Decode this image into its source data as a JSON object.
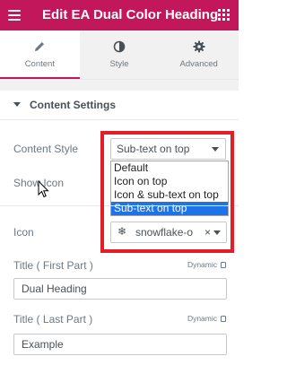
{
  "header": {
    "title": "Edit EA Dual Color Heading",
    "menu_icon": "hamburger-icon",
    "apps_icon": "grid-icon",
    "background": "#c2185b"
  },
  "tabs": [
    {
      "label": "Content",
      "icon": "pencil-icon",
      "active": true
    },
    {
      "label": "Style",
      "icon": "contrast-icon",
      "active": false
    },
    {
      "label": "Advanced",
      "icon": "gear-icon",
      "active": false
    }
  ],
  "section": {
    "title": "Content Settings"
  },
  "content_style": {
    "label": "Content Style",
    "value": "Sub-text on top",
    "options": [
      "Default",
      "Icon on top",
      "Icon & sub-text on top",
      "Sub-text on top"
    ],
    "selected_index": 3
  },
  "show_icon": {
    "label": "Show Icon"
  },
  "icon_field": {
    "label": "Icon",
    "value": "snowflake-o",
    "glyph": "❄",
    "clear": "×"
  },
  "title_first": {
    "label": "Title ( First Part )",
    "dynamic": "Dynamic",
    "value": "Dual Heading"
  },
  "title_last": {
    "label": "Title ( Last Part )",
    "dynamic": "Dynamic",
    "value": "Example"
  },
  "highlight_color": "#e41e26"
}
